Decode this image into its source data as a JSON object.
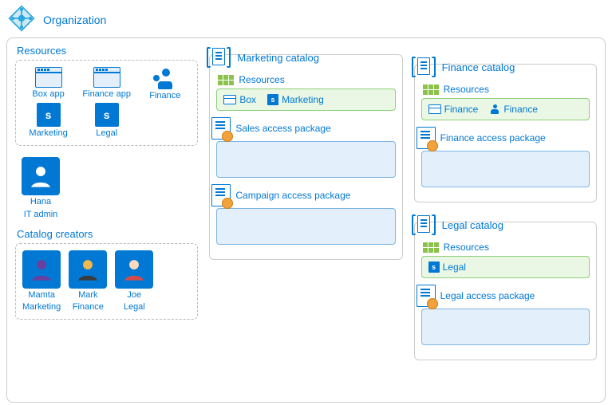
{
  "org": {
    "title": "Organization"
  },
  "left": {
    "resources_title": "Resources",
    "resources": [
      {
        "label": "Box app",
        "icon": "app"
      },
      {
        "label": "Finance app",
        "icon": "app"
      },
      {
        "label": "Finance",
        "icon": "group"
      },
      {
        "label": "Marketing",
        "icon": "sharepoint"
      },
      {
        "label": "Legal",
        "icon": "sharepoint"
      }
    ],
    "admin": {
      "name": "Hana",
      "role": "IT admin"
    },
    "creators_title": "Catalog creators",
    "creators": [
      {
        "name": "Mamta",
        "role": "Marketing"
      },
      {
        "name": "Mark",
        "role": "Finance"
      },
      {
        "name": "Joe",
        "role": "Legal"
      }
    ]
  },
  "catalogs": {
    "marketing": {
      "title": "Marketing catalog",
      "resources_label": "Resources",
      "resources": [
        {
          "label": "Box",
          "icon": "app"
        },
        {
          "label": "Marketing",
          "icon": "sharepoint"
        }
      ],
      "packages": [
        {
          "label": "Sales access package"
        },
        {
          "label": "Campaign access package"
        }
      ]
    },
    "finance": {
      "title": "Finance catalog",
      "resources_label": "Resources",
      "resources": [
        {
          "label": "Finance",
          "icon": "app"
        },
        {
          "label": "Finance",
          "icon": "group"
        }
      ],
      "packages": [
        {
          "label": "Finance access package"
        }
      ]
    },
    "legal": {
      "title": "Legal catalog",
      "resources_label": "Resources",
      "resources": [
        {
          "label": "Legal",
          "icon": "sharepoint"
        }
      ],
      "packages": [
        {
          "label": "Legal access package"
        }
      ]
    }
  }
}
